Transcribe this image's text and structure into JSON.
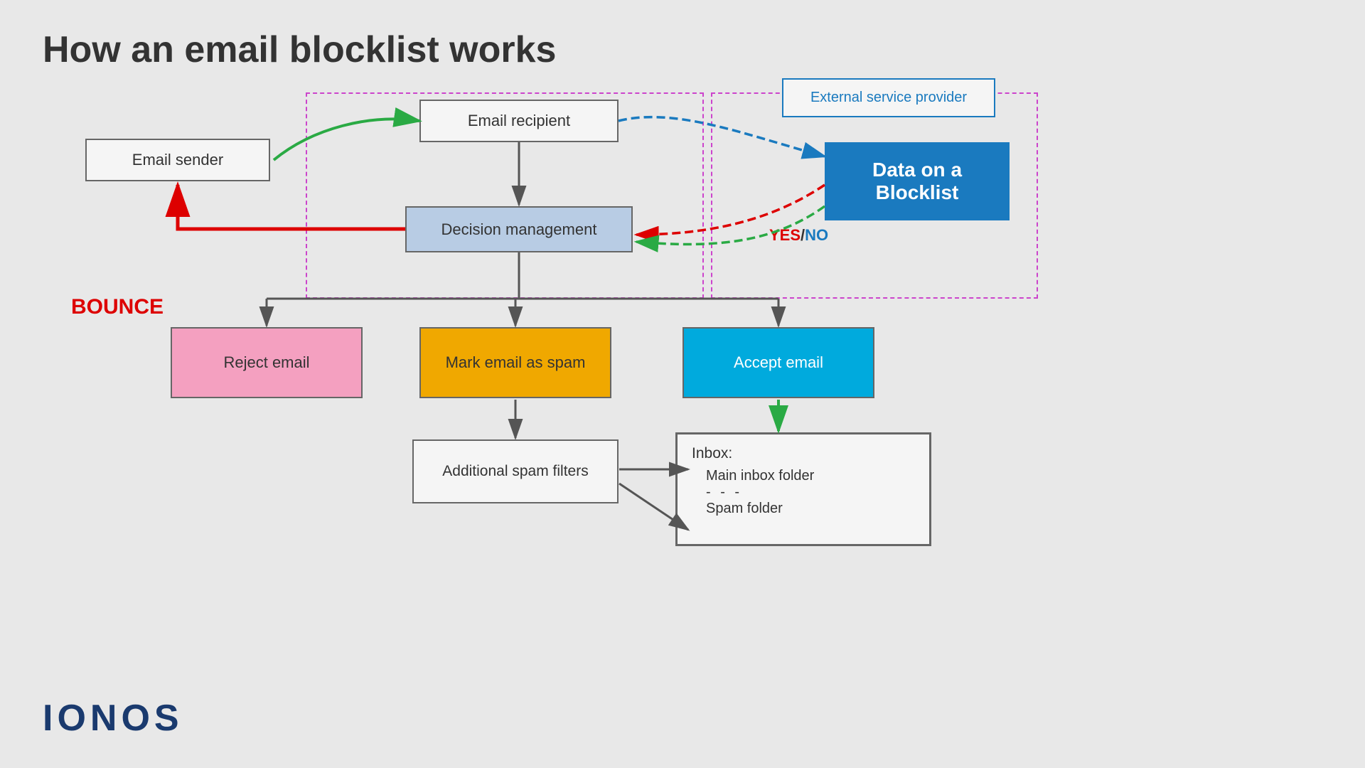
{
  "title": "How an email blocklist works",
  "boxes": {
    "email_sender": "Email sender",
    "email_recipient": "Email recipient",
    "decision": "Decision management",
    "reject": "Reject email",
    "spam": "Mark email as spam",
    "accept": "Accept email",
    "additional_spam": "Additional spam filters",
    "blocklist": "Data on a Blocklist",
    "external": "External service provider",
    "inbox_title": "Inbox:",
    "inbox_main": "Main inbox folder",
    "inbox_dots": "- - -",
    "inbox_spam": "Spam folder"
  },
  "labels": {
    "bounce": "BOUNCE",
    "yes": "YES",
    "no": "NO",
    "yes_no_separator": "/"
  },
  "logo": "IONOS",
  "colors": {
    "green": "#2aaa44",
    "red": "#dd0000",
    "blue_dashed": "#1a7abf",
    "green_dashed": "#2aaa44",
    "red_dashed": "#dd0000",
    "dark_arrow": "#555",
    "pink_dashed": "#cc44cc"
  }
}
